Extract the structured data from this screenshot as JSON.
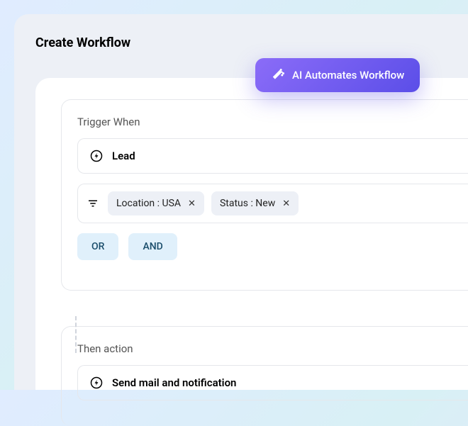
{
  "page": {
    "title": "Create Workflow"
  },
  "ai_button": {
    "label": "AI Automates Workflow"
  },
  "trigger": {
    "section_label": "Trigger When",
    "entity": "Lead",
    "filters": [
      {
        "label": "Location : USA"
      },
      {
        "label": "Status : New"
      }
    ],
    "logic": {
      "or": "OR",
      "and": "AND"
    }
  },
  "action": {
    "section_label": "Then action",
    "entity": "Send mail and notification"
  }
}
